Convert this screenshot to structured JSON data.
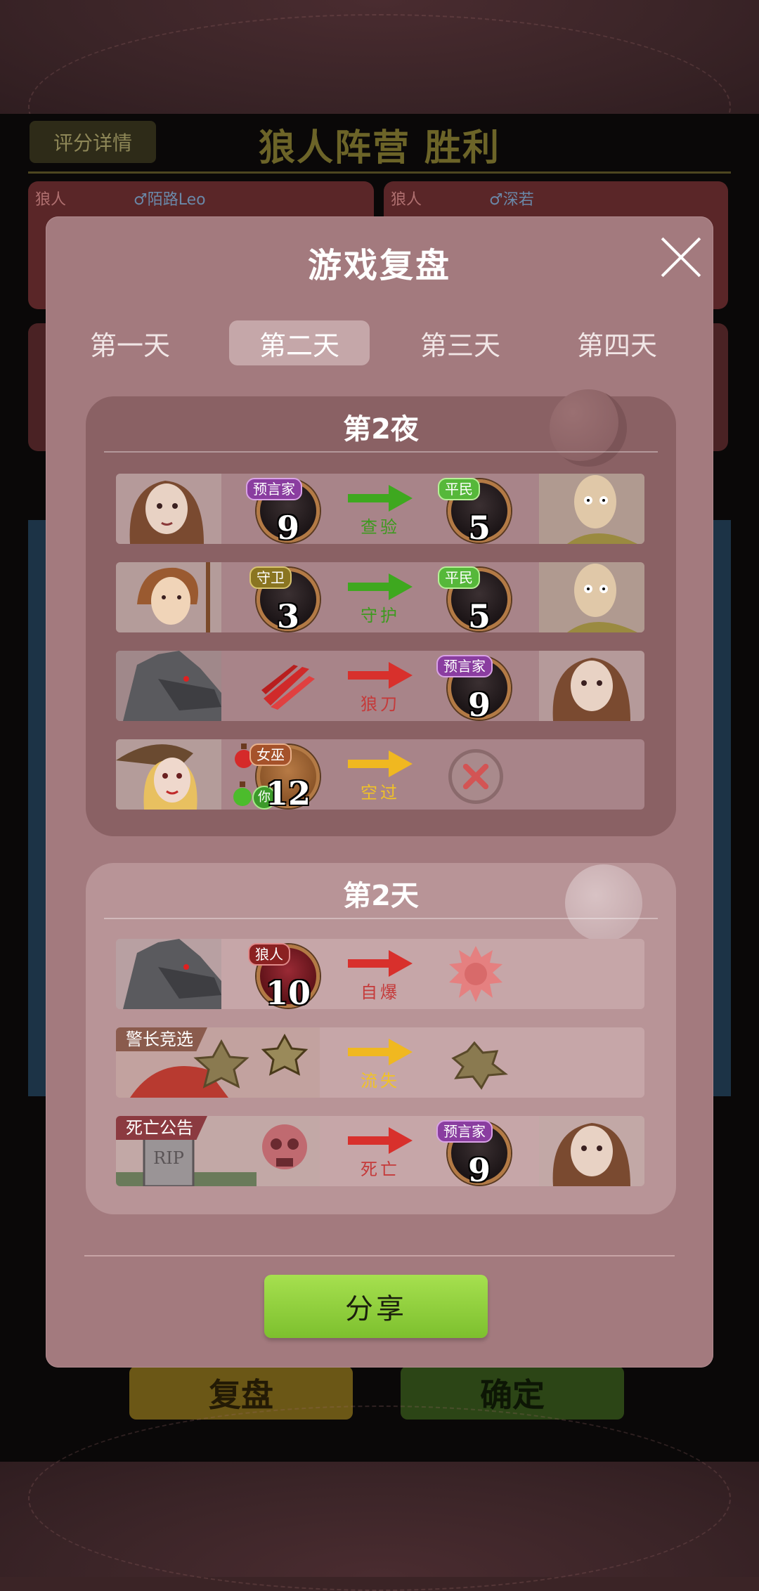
{
  "background": {
    "score_button": "评分详情",
    "result_title": "狼人阵营 胜利",
    "players": [
      {
        "tag": "狼人",
        "name": "♂陌路Leo"
      },
      {
        "tag": "狼人",
        "name": "♂深若"
      }
    ],
    "replay_label": "复盘",
    "confirm_label": "确定"
  },
  "modal": {
    "title": "游戏复盘",
    "tabs": [
      {
        "label": "第一天"
      },
      {
        "label": "第二天"
      },
      {
        "label": "第三天"
      },
      {
        "label": "第四天"
      }
    ],
    "active_tab": "第二天",
    "night": {
      "title": "第2夜",
      "rows": [
        {
          "actor_role": "预言家",
          "actor_seat": "9",
          "action": "查验",
          "target_role": "平民",
          "target_seat": "5"
        },
        {
          "actor_role": "守卫",
          "actor_seat": "3",
          "action": "守护",
          "target_role": "平民",
          "target_seat": "5"
        },
        {
          "actor_role": "",
          "actor_seat": "",
          "action": "狼刀",
          "target_role": "预言家",
          "target_seat": "9"
        },
        {
          "actor_role": "女巫",
          "actor_seat": "12",
          "you_label": "你",
          "action": "空过",
          "target_role": "",
          "target_seat": ""
        }
      ]
    },
    "day": {
      "title": "第2天",
      "rows": [
        {
          "actor_role": "狼人",
          "actor_seat": "10",
          "action": "自爆"
        },
        {
          "corner": "警长竞选",
          "action": "流失"
        },
        {
          "corner": "死亡公告",
          "action": "死亡",
          "target_role": "预言家",
          "target_seat": "9"
        }
      ]
    },
    "share_label": "分享"
  },
  "colors": {
    "modal_bg": "#a37a7e",
    "night_section": "#8a6164",
    "day_section": "#b89497",
    "action_green": "#3d9a1e",
    "action_red": "#c53a3a",
    "action_yellow": "#f0c227",
    "share_green": "#8fd33a"
  }
}
